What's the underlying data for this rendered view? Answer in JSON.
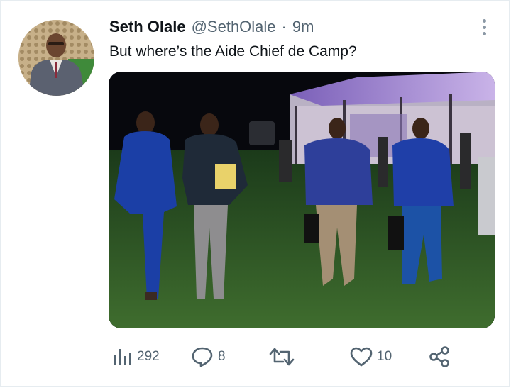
{
  "tweet": {
    "author_name": "Seth Olale",
    "author_handle": "@SethOlale",
    "separator": "·",
    "timestamp": "9m",
    "text": "But where’s the Aide Chief de Camp?"
  },
  "actions": {
    "views": "292",
    "replies": "8",
    "retweets": "",
    "likes": "10"
  },
  "icons": {
    "views": "analytics-icon",
    "reply": "reply-icon",
    "retweet": "retweet-icon",
    "like": "heart-icon",
    "share": "share-icon",
    "more": "more-icon"
  },
  "colors": {
    "text_primary": "#0f1419",
    "text_secondary": "#536471"
  }
}
